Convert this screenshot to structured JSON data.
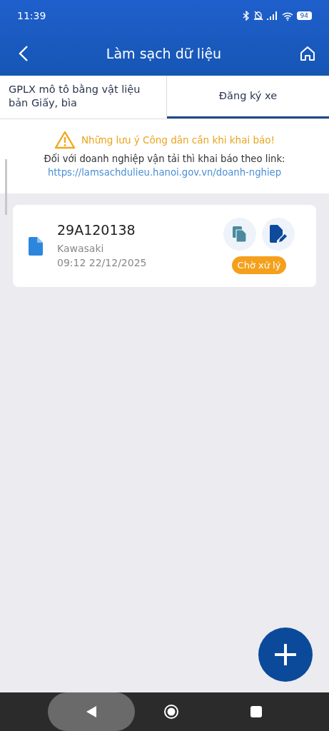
{
  "status_bar": {
    "time": "11:39",
    "battery": "94"
  },
  "header": {
    "title": "Làm sạch dữ liệu"
  },
  "tabs": [
    {
      "label": "GPLX mô tô bằng vật liệu bản Giấy, bìa",
      "selected": false
    },
    {
      "label": "Đăng ký xe",
      "selected": true
    }
  ],
  "notice": {
    "warning": "Những lưu ý Công dân cần khi khai báo!",
    "text": "Đối với doanh nghiệp vận tải thì khai báo theo link:",
    "link": "https://lamsachdulieu.hanoi.gov.vn/doanh-nghiep"
  },
  "records": [
    {
      "plate": "29A120138",
      "brand": "Kawasaki",
      "time": "09:12 22/12/2025",
      "status": "Chờ xử lý",
      "color": "#f5a01d"
    }
  ]
}
